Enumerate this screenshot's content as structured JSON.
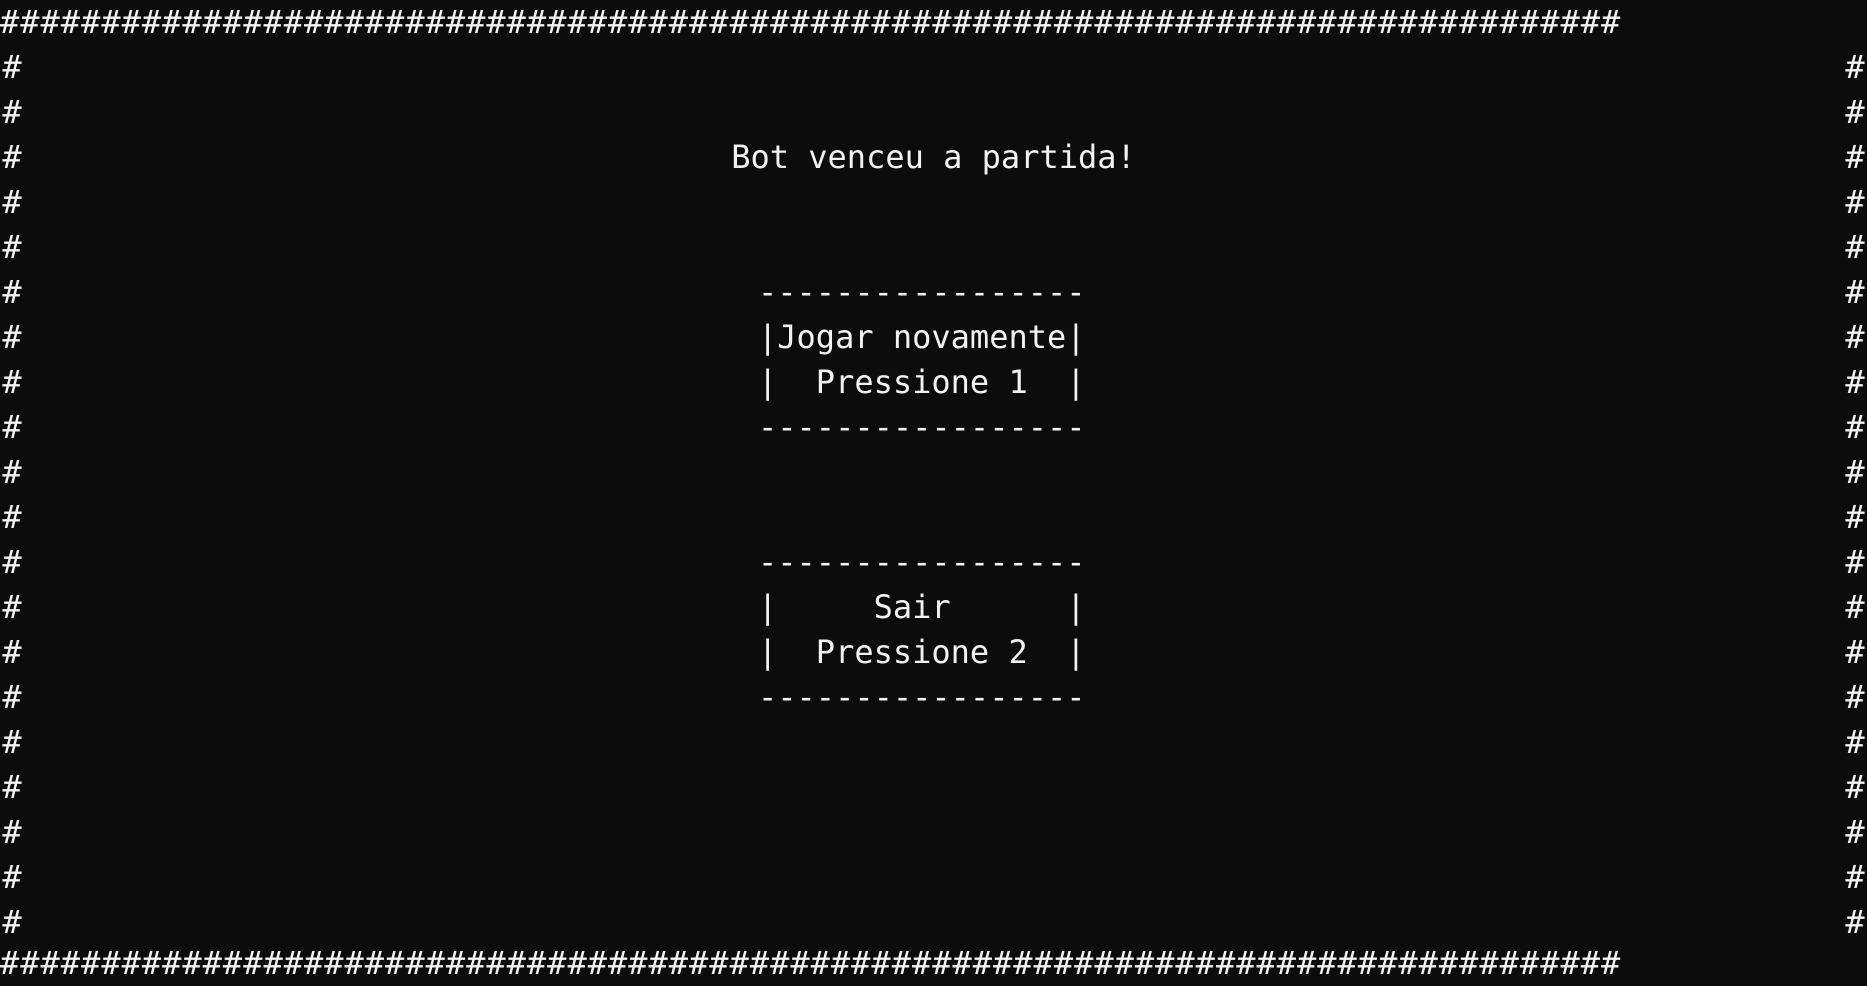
{
  "border_char": "#",
  "title": "Bot venceu a partida!",
  "menu": [
    {
      "label_line": "|Jogar novamente|",
      "key_line": "|  Pressione 1  |"
    },
    {
      "label_line": "|     Sair      |",
      "key_line": "|  Pressione 2  |"
    }
  ],
  "rule_line": "-----------------"
}
